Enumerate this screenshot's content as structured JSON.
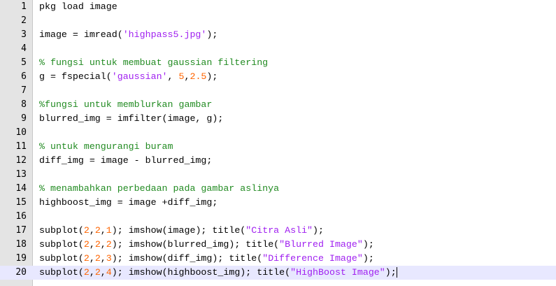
{
  "colors": {
    "gutter_bg": "#e4e4e4",
    "active_line_bg": "#e8e8ff",
    "number": "#ff6400",
    "string": "#a020f0",
    "comment": "#228b22",
    "text": "#000000"
  },
  "active_line": 20,
  "lines": [
    {
      "num": "1",
      "tokens": [
        {
          "t": "pkg load image",
          "k": "plain"
        }
      ]
    },
    {
      "num": "2",
      "tokens": []
    },
    {
      "num": "3",
      "tokens": [
        {
          "t": "image = imread(",
          "k": "plain"
        },
        {
          "t": "'highpass5.jpg'",
          "k": "string"
        },
        {
          "t": ");",
          "k": "plain"
        }
      ]
    },
    {
      "num": "4",
      "tokens": []
    },
    {
      "num": "5",
      "tokens": [
        {
          "t": "% fungsi untuk membuat gaussian filtering",
          "k": "comment"
        }
      ]
    },
    {
      "num": "6",
      "tokens": [
        {
          "t": "g = fspecial(",
          "k": "plain"
        },
        {
          "t": "'gaussian'",
          "k": "string"
        },
        {
          "t": ", ",
          "k": "plain"
        },
        {
          "t": "5",
          "k": "number"
        },
        {
          "t": ",",
          "k": "plain"
        },
        {
          "t": "2.5",
          "k": "number"
        },
        {
          "t": ");",
          "k": "plain"
        }
      ]
    },
    {
      "num": "7",
      "tokens": []
    },
    {
      "num": "8",
      "tokens": [
        {
          "t": "%fungsi untuk memblurkan gambar",
          "k": "comment"
        }
      ]
    },
    {
      "num": "9",
      "tokens": [
        {
          "t": "blurred_img = imfilter(image, g);",
          "k": "plain"
        }
      ]
    },
    {
      "num": "10",
      "tokens": []
    },
    {
      "num": "11",
      "tokens": [
        {
          "t": "% untuk mengurangi buram",
          "k": "comment"
        }
      ]
    },
    {
      "num": "12",
      "tokens": [
        {
          "t": "diff_img = image - blurred_img;",
          "k": "plain"
        }
      ]
    },
    {
      "num": "13",
      "tokens": []
    },
    {
      "num": "14",
      "tokens": [
        {
          "t": "% menambahkan perbedaan pada gambar aslinya",
          "k": "comment"
        }
      ]
    },
    {
      "num": "15",
      "tokens": [
        {
          "t": "highboost_img = image +diff_img;",
          "k": "plain"
        }
      ]
    },
    {
      "num": "16",
      "tokens": []
    },
    {
      "num": "17",
      "tokens": [
        {
          "t": "subplot(",
          "k": "plain"
        },
        {
          "t": "2",
          "k": "number"
        },
        {
          "t": ",",
          "k": "plain"
        },
        {
          "t": "2",
          "k": "number"
        },
        {
          "t": ",",
          "k": "plain"
        },
        {
          "t": "1",
          "k": "number"
        },
        {
          "t": "); imshow(image); title(",
          "k": "plain"
        },
        {
          "t": "\"Citra Asli\"",
          "k": "string"
        },
        {
          "t": ");",
          "k": "plain"
        }
      ]
    },
    {
      "num": "18",
      "tokens": [
        {
          "t": "subplot(",
          "k": "plain"
        },
        {
          "t": "2",
          "k": "number"
        },
        {
          "t": ",",
          "k": "plain"
        },
        {
          "t": "2",
          "k": "number"
        },
        {
          "t": ",",
          "k": "plain"
        },
        {
          "t": "2",
          "k": "number"
        },
        {
          "t": "); imshow(blurred_img); title(",
          "k": "plain"
        },
        {
          "t": "\"Blurred Image\"",
          "k": "string"
        },
        {
          "t": ");",
          "k": "plain"
        }
      ]
    },
    {
      "num": "19",
      "tokens": [
        {
          "t": "subplot(",
          "k": "plain"
        },
        {
          "t": "2",
          "k": "number"
        },
        {
          "t": ",",
          "k": "plain"
        },
        {
          "t": "2",
          "k": "number"
        },
        {
          "t": ",",
          "k": "plain"
        },
        {
          "t": "3",
          "k": "number"
        },
        {
          "t": "); imshow(diff_img); title(",
          "k": "plain"
        },
        {
          "t": "\"Difference Image\"",
          "k": "string"
        },
        {
          "t": ");",
          "k": "plain"
        }
      ]
    },
    {
      "num": "20",
      "tokens": [
        {
          "t": "subplot(",
          "k": "plain"
        },
        {
          "t": "2",
          "k": "number"
        },
        {
          "t": ",",
          "k": "plain"
        },
        {
          "t": "2",
          "k": "number"
        },
        {
          "t": ",",
          "k": "plain"
        },
        {
          "t": "4",
          "k": "number"
        },
        {
          "t": "); imshow(highboost_img); title(",
          "k": "plain"
        },
        {
          "t": "\"HighBoost Image\"",
          "k": "string"
        },
        {
          "t": ");",
          "k": "plain"
        }
      ]
    }
  ]
}
